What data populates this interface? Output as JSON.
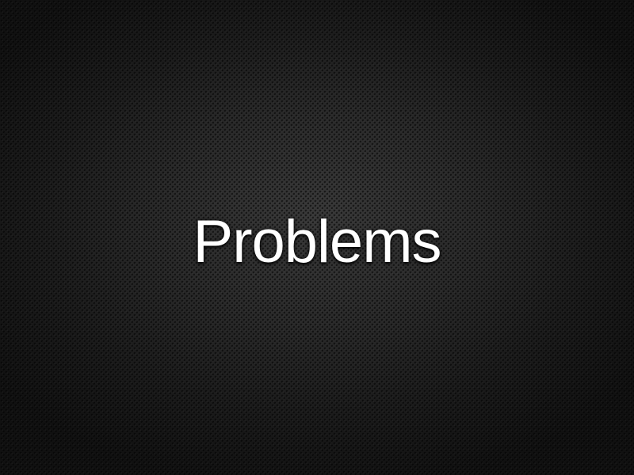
{
  "slide": {
    "title": "Problems"
  },
  "colors": {
    "background": "#2b2b2b",
    "text": "#ffffff"
  }
}
